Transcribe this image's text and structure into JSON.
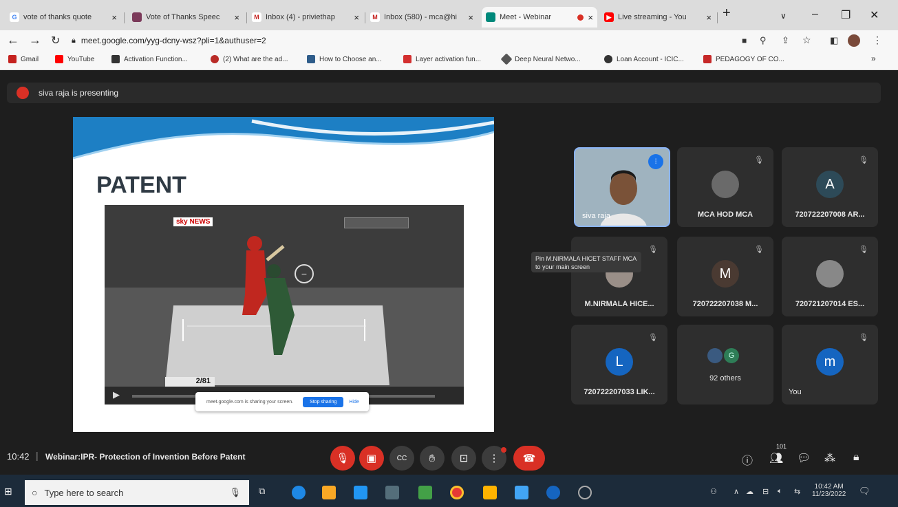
{
  "tabs": [
    {
      "label": "vote of thanks quote",
      "favicon": "google-icon",
      "color": "#4285f4"
    },
    {
      "label": "Vote of Thanks Speec",
      "favicon": "document-icon",
      "color": "#7b3a5a"
    },
    {
      "label": "Inbox (4) - priviethap",
      "favicon": "gmail-icon",
      "color": "#c5221f"
    },
    {
      "label": "Inbox (580) - mca@hi",
      "favicon": "gmail-icon",
      "color": "#c5221f"
    },
    {
      "label": "Meet - Webinar",
      "favicon": "meet-icon",
      "color": "#00897b"
    },
    {
      "label": "Live streaming - You",
      "favicon": "youtube-icon",
      "color": "#ff0000"
    }
  ],
  "url": "meet.google.com/yyg-dcny-wsz?pli=1&authuser=2",
  "bookmarks": [
    {
      "label": "Gmail",
      "color": "#c5221f"
    },
    {
      "label": "YouTube",
      "color": "#ff0000"
    },
    {
      "label": "Activation Function...",
      "color": "#333333"
    },
    {
      "label": "(2) What are the ad...",
      "color": "#b92b27"
    },
    {
      "label": "How to Choose an...",
      "color": "#2e5c8a"
    },
    {
      "label": "Layer activation fun...",
      "color": "#d32f2f"
    },
    {
      "label": "Deep Neural Netwo...",
      "color": "#555555"
    },
    {
      "label": "Loan Account - ICIC...",
      "color": "#333333"
    },
    {
      "label": "PEDAGOGY OF CO...",
      "color": "#c62828"
    }
  ],
  "presenter_banner": "siva raja is presenting",
  "slide": {
    "title": "PATENT",
    "video_channel": "sky NEWS",
    "score": "2/81",
    "share_notice": "meet.google.com is sharing your screen.",
    "share_stop": "Stop sharing",
    "share_hide": "Hide"
  },
  "participants": [
    {
      "name": "siva raja",
      "initial": "",
      "avatar_color": "#6d8b9c",
      "active": true
    },
    {
      "name": "MCA HOD MCA",
      "initial": "",
      "avatar_color": "#6a6a6a"
    },
    {
      "name": "720722207008 AR...",
      "initial": "A",
      "avatar_color": "#2d4a58"
    },
    {
      "name": "M.NIRMALA HICE...",
      "initial": "",
      "avatar_color": "#9a8f88"
    },
    {
      "name": "720722207038 M...",
      "initial": "M",
      "avatar_color": "#4a3a32"
    },
    {
      "name": "720721207014 ES...",
      "initial": "",
      "avatar_color": "#888888"
    },
    {
      "name": "720722207033 LIK...",
      "initial": "L",
      "avatar_color": "#1565c0"
    },
    {
      "name": "92 others",
      "initial": "G",
      "avatar_color": "#2e7d57"
    },
    {
      "name": "You",
      "initial": "m",
      "avatar_color": "#1565c0"
    }
  ],
  "pin_tooltip": "Pin M.NIRMALA HICET STAFF MCA to your main screen",
  "meeting": {
    "time": "10:42",
    "title": "Webinar:IPR- Protection of Invention Before Patent",
    "participant_count": "101"
  },
  "taskbar": {
    "search_placeholder": "Type here to search",
    "clock_time": "10:42 AM",
    "clock_date": "11/23/2022"
  }
}
